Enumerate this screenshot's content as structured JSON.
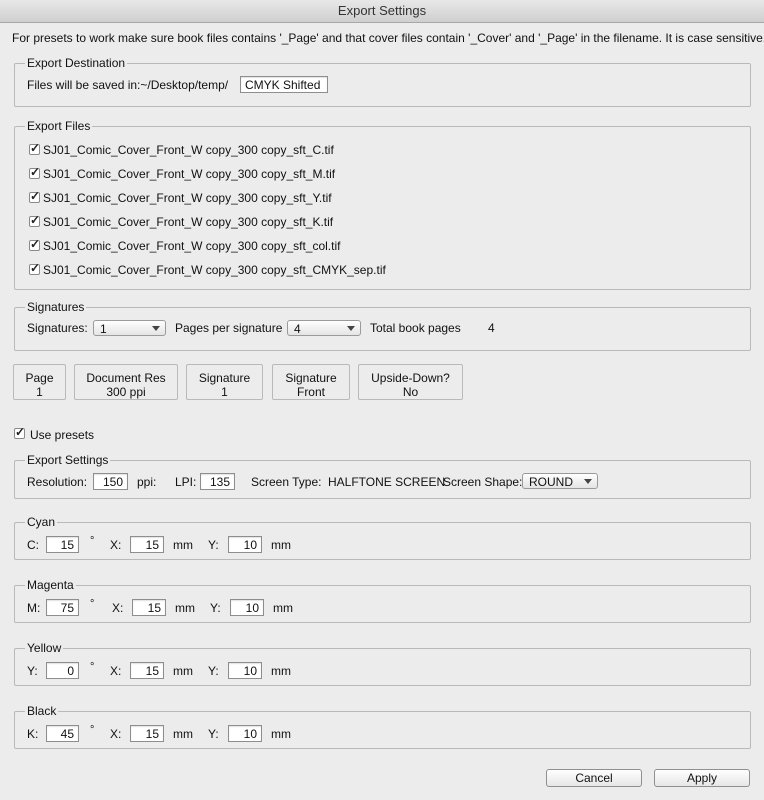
{
  "window": {
    "title": "Export Settings"
  },
  "instructions": "For presets to work make sure book files contains '_Page' and that cover files contain '_Cover' and '_Page' in the filename.  It is case sensitive.",
  "export_destination": {
    "group_title": "Export Destination",
    "label": "Files will be saved in:~/Desktop/temp/",
    "folder_value": "CMYK Shifted"
  },
  "export_files": {
    "group_title": "Export Files",
    "files": [
      {
        "name": "SJ01_Comic_Cover_Front_W copy_300 copy_sft_C.tif",
        "checked": true
      },
      {
        "name": "SJ01_Comic_Cover_Front_W copy_300 copy_sft_M.tif",
        "checked": true
      },
      {
        "name": "SJ01_Comic_Cover_Front_W copy_300 copy_sft_Y.tif",
        "checked": true
      },
      {
        "name": "SJ01_Comic_Cover_Front_W copy_300 copy_sft_K.tif",
        "checked": true
      },
      {
        "name": "SJ01_Comic_Cover_Front_W copy_300 copy_sft_col.tif",
        "checked": true
      },
      {
        "name": "SJ01_Comic_Cover_Front_W copy_300 copy_sft_CMYK_sep.tif",
        "checked": true
      }
    ]
  },
  "signatures": {
    "group_title": "Signatures",
    "signatures_label": "Signatures:",
    "signatures_value": "1",
    "pages_label": "Pages per signature",
    "pages_value": "4",
    "total_label": "Total book pages",
    "total_value": "4"
  },
  "info_boxes": [
    {
      "title": "Page",
      "value": "1"
    },
    {
      "title": "Document Res",
      "value": "300 ppi"
    },
    {
      "title": "Signature",
      "value": "1"
    },
    {
      "title": "Signature",
      "value": "Front"
    },
    {
      "title": "Upside-Down?",
      "value": "No"
    }
  ],
  "use_presets": {
    "label": "Use presets",
    "checked": true
  },
  "export_settings": {
    "group_title": "Export Settings",
    "resolution_label": "Resolution:",
    "resolution_value": "150",
    "ppi_label": "ppi:",
    "lpi_label": "LPI:",
    "lpi_value": "135",
    "screen_type_label": "Screen Type:",
    "screen_type_value": "HALFTONE SCREEN",
    "screen_shape_label": "Screen Shape:",
    "screen_shape_value": "ROUND"
  },
  "channels": [
    {
      "group_title": "Cyan",
      "angle_label": "C:",
      "angle": "15",
      "x": "15",
      "y": "10"
    },
    {
      "group_title": "Magenta",
      "angle_label": "M:",
      "angle": "75",
      "x": "15",
      "y": "10"
    },
    {
      "group_title": "Yellow",
      "angle_label": "Y:",
      "angle": "0",
      "x": "15",
      "y": "10"
    },
    {
      "group_title": "Black",
      "angle_label": "K:",
      "angle": "45",
      "x": "15",
      "y": "10"
    }
  ],
  "channel_labels": {
    "degree": "°",
    "x_label": "X:",
    "y_label": "Y:",
    "unit": "mm"
  },
  "buttons": {
    "cancel": "Cancel",
    "apply": "Apply"
  }
}
